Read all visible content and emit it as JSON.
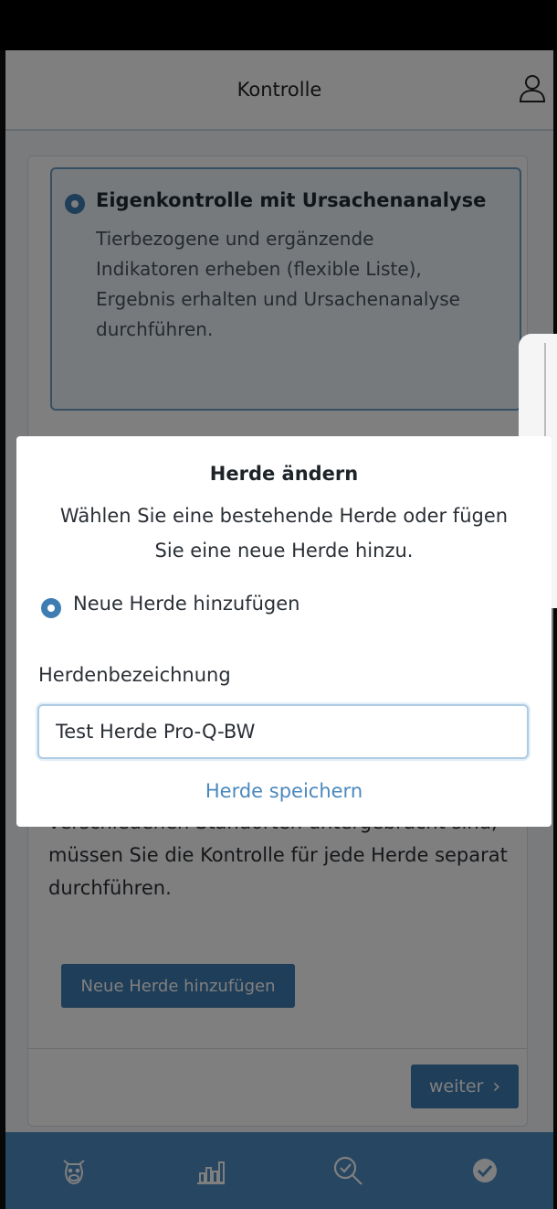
{
  "header": {
    "title": "Kontrolle",
    "user_icon": "user-icon"
  },
  "option": {
    "title": "Eigenkontrolle mit Ursachenanalyse",
    "description": "Tierbezogene und ergänzende Indikatoren erheben (flexible Liste), Ergebnis erhalten und Ursachenanalyse durchführen.",
    "selected": true
  },
  "info": {
    "text": "verschiedenen Standorten untergebracht sind, müssen Sie die Kontrolle für jede Herde separat durchführen."
  },
  "buttons": {
    "add_herd": "Neue Herde hinzufügen",
    "next": "weiter"
  },
  "bottom_nav": [
    "cow-icon",
    "bar-chart-icon",
    "search-analysis-icon",
    "check-circle-icon"
  ],
  "dialog": {
    "title": "Herde ändern",
    "message": "Wählen Sie eine bestehende Herde oder fügen Sie eine neue Herde hinzu.",
    "radio_label": "Neue Herde hinzufügen",
    "field_label": "Herdenbezeichnung",
    "field_value": "Test Herde Pro-Q-BW",
    "save_label": "Herde speichern"
  },
  "colors": {
    "accent": "#3e7db2",
    "nav": "#4d8dc4",
    "link": "#4b88bd"
  }
}
